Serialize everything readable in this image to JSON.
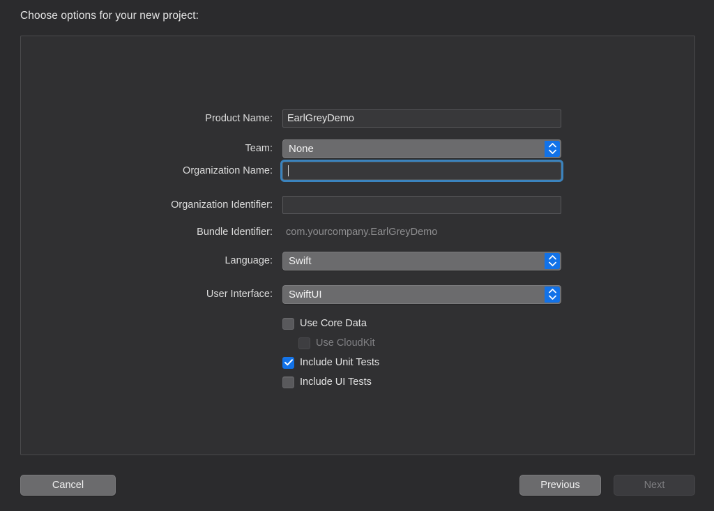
{
  "header": {
    "title": "Choose options for your new project:"
  },
  "form": {
    "rows": [
      {
        "label": "Product Name:",
        "type": "text",
        "value": "EarlGreyDemo",
        "focused": false
      },
      {
        "label": "Team:",
        "type": "popup",
        "value": "None"
      },
      {
        "label": "Organization Name:",
        "type": "text",
        "value": "",
        "focused": true
      },
      {
        "label": "Organization Identifier:",
        "type": "text",
        "value": "",
        "focused": false
      },
      {
        "label": "Bundle Identifier:",
        "type": "static",
        "value": "com.yourcompany.EarlGreyDemo"
      },
      {
        "label": "Language:",
        "type": "popup",
        "value": "Swift"
      },
      {
        "label": "User Interface:",
        "type": "popup",
        "value": "SwiftUI"
      }
    ]
  },
  "checkboxes": [
    {
      "label": "Use Core Data",
      "checked": false,
      "disabled": false,
      "indented": false
    },
    {
      "label": "Use CloudKit",
      "checked": false,
      "disabled": true,
      "indented": true
    },
    {
      "label": "Include Unit Tests",
      "checked": true,
      "disabled": false,
      "indented": false
    },
    {
      "label": "Include UI Tests",
      "checked": false,
      "disabled": false,
      "indented": false
    }
  ],
  "footer": {
    "cancel_label": "Cancel",
    "previous_label": "Previous",
    "next_label": "Next",
    "next_disabled": true
  },
  "colors": {
    "window_background": "#2b2b2d",
    "panel_background": "#303032",
    "accent_blue": "#1272e8",
    "focus_ring": "#3b83bd",
    "control_gray": "#6b6b6d",
    "field_background": "#38383a",
    "text_primary": "#e4e4e4",
    "text_secondary": "#8e8e90",
    "text_disabled": "#7e7e81"
  }
}
